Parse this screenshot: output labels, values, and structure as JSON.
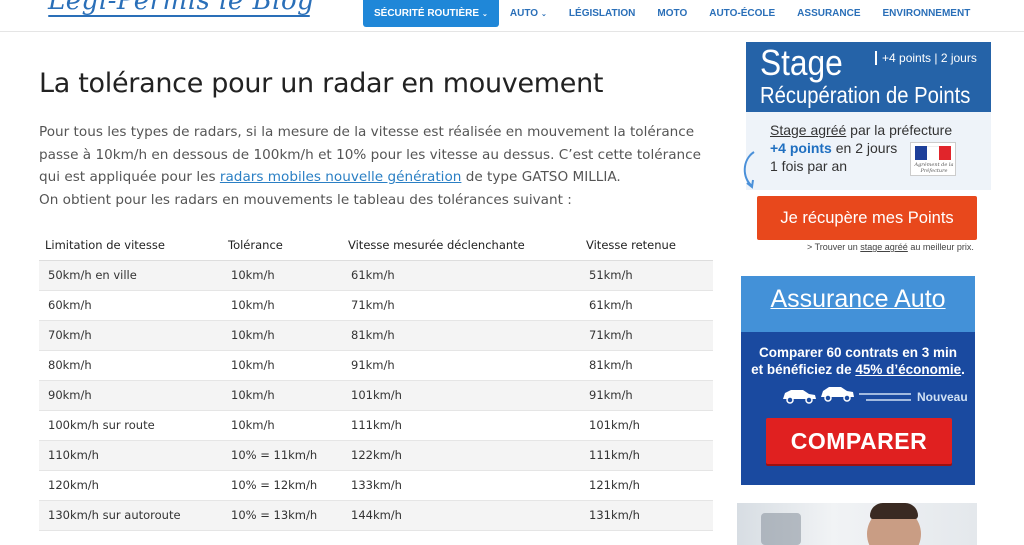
{
  "header": {
    "logo_text": "Legi-Permis le Blog",
    "nav": [
      {
        "label": "SÉCURITÉ ROUTIÈRE",
        "active": true,
        "has_caret": true
      },
      {
        "label": "AUTO",
        "active": false,
        "has_caret": true
      },
      {
        "label": "LÉGISLATION",
        "active": false,
        "has_caret": false
      },
      {
        "label": "MOTO",
        "active": false,
        "has_caret": false
      },
      {
        "label": "AUTO-ÉCOLE",
        "active": false,
        "has_caret": false
      },
      {
        "label": "ASSURANCE",
        "active": false,
        "has_caret": false
      },
      {
        "label": "ENVIRONNEMENT",
        "active": false,
        "has_caret": false
      }
    ],
    "caret_glyph": "⌄"
  },
  "article": {
    "title": "La tolérance pour un radar en mouvement",
    "para_part1": "Pour tous les types de radars, si la mesure de la vitesse est réalisée en mouvement la tolérance passe à 10km/h en dessous de 100km/h et 10% pour les vitesse au dessus. C’est cette tolérance qui est appliquée pour les ",
    "para_link": "radars mobiles nouvelle génération",
    "para_part2": " de type GATSO MILLIA.",
    "para_line2": "On obtient pour les radars en mouvements le tableau des tolérances suivant :",
    "table": {
      "headers": [
        "Limitation de vitesse",
        "Tolérance",
        "Vitesse mesurée déclenchante",
        "Vitesse retenue"
      ],
      "rows": [
        [
          "50km/h en ville",
          "10km/h",
          "61km/h",
          "51km/h"
        ],
        [
          "60km/h",
          "10km/h",
          "71km/h",
          "61km/h"
        ],
        [
          "70km/h",
          "10km/h",
          "81km/h",
          "71km/h"
        ],
        [
          "80km/h",
          "10km/h",
          "91km/h",
          "81km/h"
        ],
        [
          "90km/h",
          "10km/h",
          "101km/h",
          "91km/h"
        ],
        [
          "100km/h sur route",
          "10km/h",
          "111km/h",
          "101km/h"
        ],
        [
          "110km/h",
          "10% = 11km/h",
          "122km/h",
          "111km/h"
        ],
        [
          "120km/h",
          "10% = 12km/h",
          "133km/h",
          "121km/h"
        ],
        [
          "130km/h sur autoroute",
          "10% = 13km/h",
          "144km/h",
          "131km/h"
        ]
      ]
    }
  },
  "sidebar": {
    "stage": {
      "word": "Stage",
      "tag": "+4 points | 2 jours",
      "subtitle": "Récupération de Points",
      "line1_link": "Stage agréé",
      "line1_rest": " par la préfecture",
      "line2_bold": "+4 points",
      "line2_rest": " en 2 jours",
      "line3": "1 fois par an",
      "flag_caption": "Agrément de la Préfecture",
      "cta": "Je récupère mes Points",
      "note_prefix": "> Trouver un ",
      "note_link": "stage agréé",
      "note_suffix": " au meilleur prix."
    },
    "assurance": {
      "title": "Assurance Auto",
      "line1": "Comparer 60 contrats en 3 min",
      "line2_prefix": "et bénéficiez de ",
      "line2_link": "45% d’économie",
      "line2_suffix": ".",
      "badge": "Nouveau",
      "cta": "COMPARER"
    }
  },
  "colors": {
    "brand_blue": "#2a6fb8",
    "nav_active": "#1f87d8",
    "cta_orange": "#e8481c",
    "cta_red": "#e02020",
    "assurance_dark": "#1a4aa0"
  }
}
